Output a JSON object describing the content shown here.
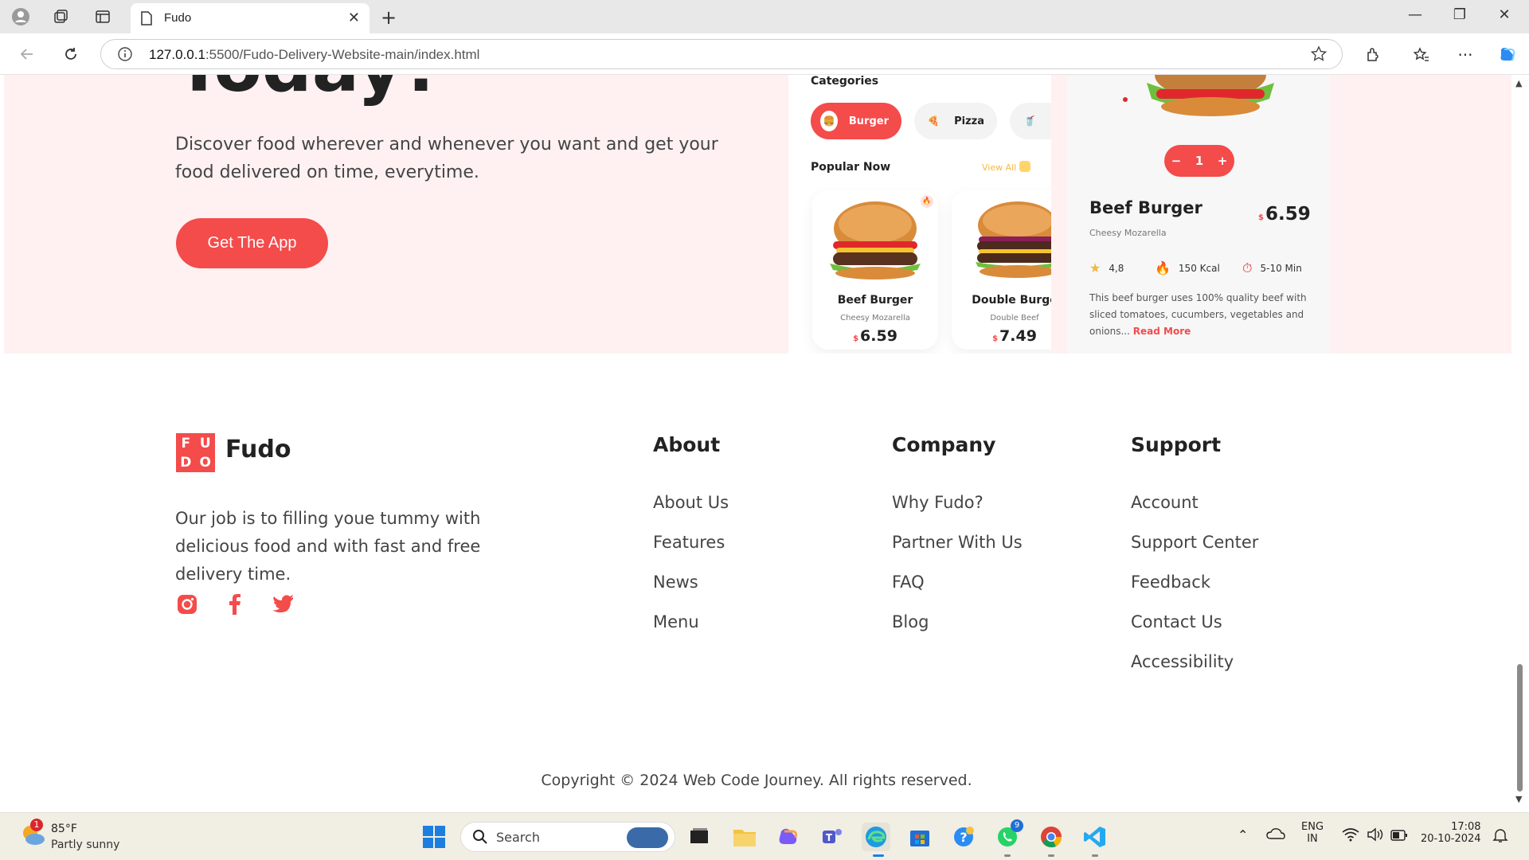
{
  "browser": {
    "tab_title": "Fudo",
    "url_host": "127.0.0.1",
    "url_rest": ":5500/Fudo-Delivery-Website-main/index.html"
  },
  "hero": {
    "heading": "Today?",
    "description": "Discover food wherever and whenever you want and get your food delivered on time, everytime.",
    "button_label": "Get The App"
  },
  "phone1": {
    "categories_title": "Categories",
    "categories": [
      "Burger",
      "Pizza"
    ],
    "popular_title": "Popular Now",
    "view_all": "View All",
    "items": [
      {
        "name": "Beef Burger",
        "sub": "Cheesy Mozarella",
        "currency": "$",
        "price": "6.59"
      },
      {
        "name": "Double Burge",
        "sub": "Double Beef",
        "currency": "$",
        "price": "7.49"
      }
    ]
  },
  "phone2": {
    "quantity": "1",
    "name": "Beef Burger",
    "sub": "Cheesy Mozarella",
    "currency": "$",
    "price": "6.59",
    "rating": "4,8",
    "kcal": "150 Kcal",
    "time": "5-10 Min",
    "description": "This beef burger uses 100% quality beef with sliced tomatoes, cucumbers, vegetables and onions...",
    "read_more": "Read More"
  },
  "footer": {
    "logo_letters": [
      "F",
      "U",
      "D",
      "O"
    ],
    "logo_text": "Fudo",
    "description": "Our job is to filling youe tummy with delicious food and with fast and free delivery time.",
    "columns": [
      {
        "title": "About",
        "links": [
          "About Us",
          "Features",
          "News",
          "Menu"
        ]
      },
      {
        "title": "Company",
        "links": [
          "Why Fudo?",
          "Partner With Us",
          "FAQ",
          "Blog"
        ]
      },
      {
        "title": "Support",
        "links": [
          "Account",
          "Support Center",
          "Feedback",
          "Contact Us",
          "Accessibility"
        ]
      }
    ],
    "copyright": "Copyright © 2024 Web Code Journey. All rights reserved."
  },
  "taskbar": {
    "weather_temp": "85°F",
    "weather_desc": "Partly sunny",
    "weather_badge": "1",
    "search_label": "Search",
    "whatsapp_badge": "9",
    "lang_top": "ENG",
    "lang_bottom": "IN",
    "time": "17:08",
    "date": "20-10-2024"
  },
  "colors": {
    "accent": "#f44b4b",
    "hero_bg": "#fff1f1"
  }
}
